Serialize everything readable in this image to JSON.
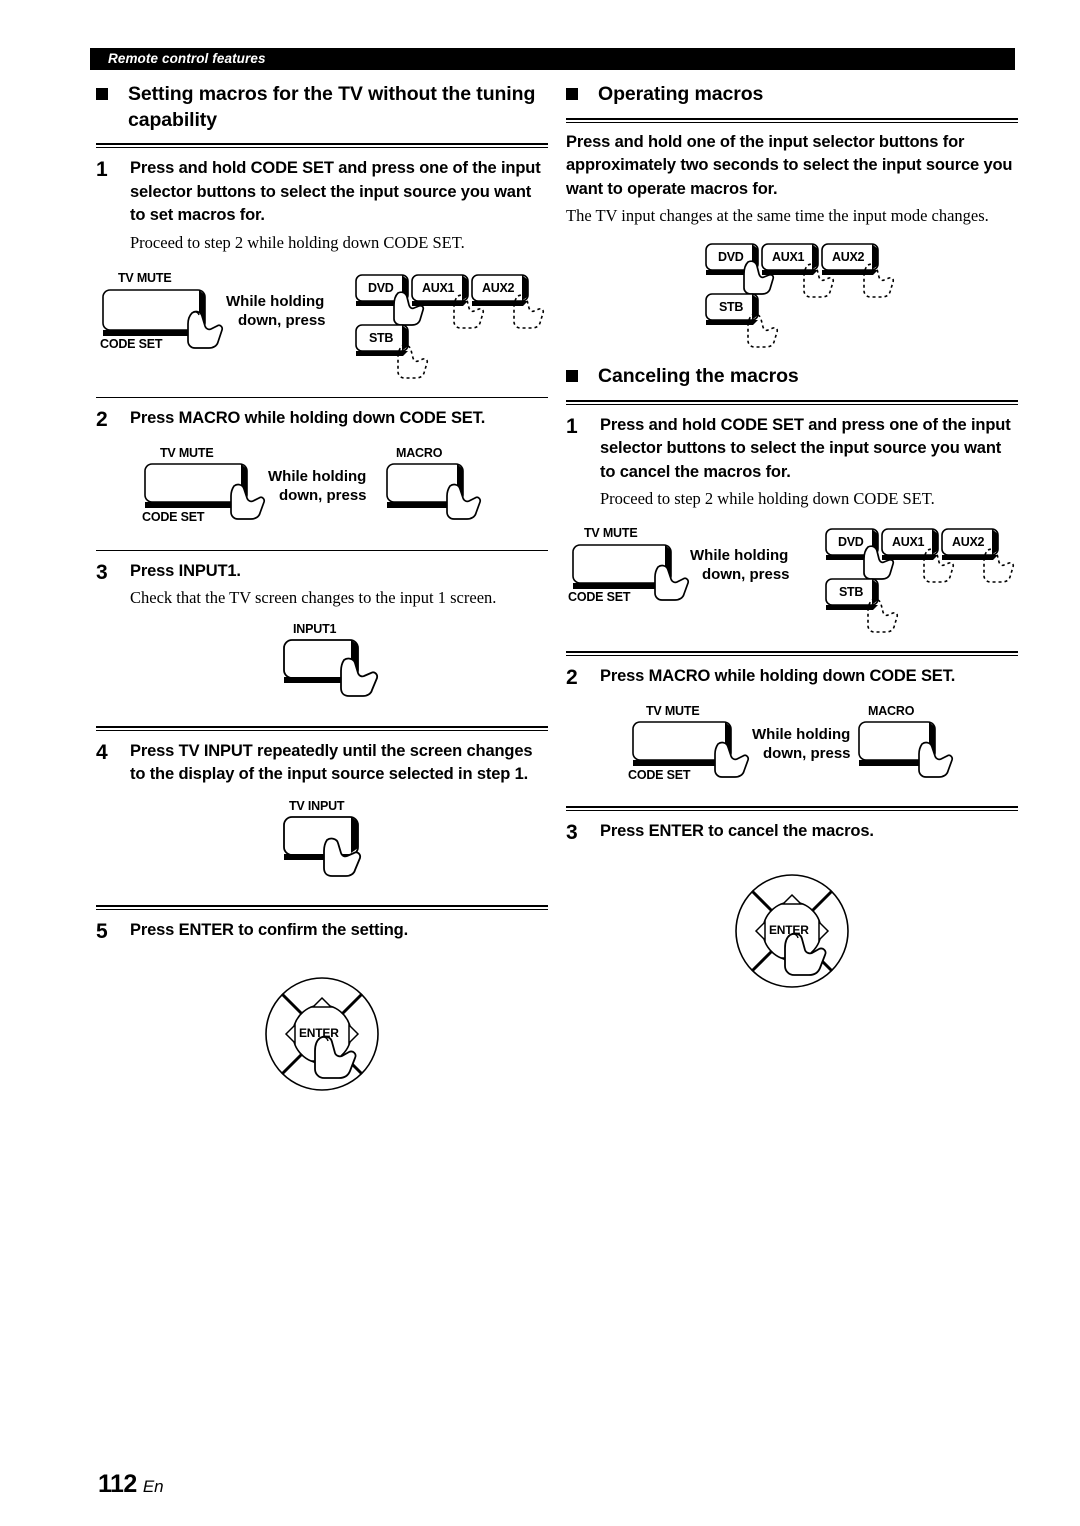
{
  "header": {
    "running_title": "Remote control features"
  },
  "footer": {
    "page_number": "112",
    "language": "En"
  },
  "left_column": {
    "section": {
      "title": "Setting macros for the TV without the tuning capability"
    },
    "steps": [
      {
        "number": "1",
        "title": "Press and hold CODE SET and press one of the input selector buttons to select the input source you want to set macros for.",
        "note": "Proceed to step 2 while holding down CODE SET.",
        "figure": {
          "type": "code-set-and-sources",
          "mute_label": "TV MUTE",
          "codeset_label": "CODE SET",
          "caption_line1": "While holding",
          "caption_line2": "down, press",
          "source_keys": [
            "DVD",
            "AUX1",
            "AUX2",
            "STB"
          ]
        }
      },
      {
        "number": "2",
        "title": "Press MACRO while holding down CODE SET.",
        "figure": {
          "type": "code-set-and-macro",
          "mute_label": "TV MUTE",
          "codeset_label": "CODE SET",
          "caption_line1": "While holding",
          "caption_line2": "down, press",
          "macro_label": "MACRO"
        }
      },
      {
        "number": "3",
        "title": "Press INPUT1.",
        "note": "Check that the TV screen changes to the input 1 screen.",
        "figure": {
          "type": "single-key",
          "key_label": "INPUT1"
        }
      },
      {
        "number": "4",
        "title": "Press TV INPUT repeatedly until the screen changes to the display of the input source selected in step 1.",
        "figure": {
          "type": "single-key",
          "key_label": "TV INPUT"
        }
      },
      {
        "number": "5",
        "title": "Press ENTER to confirm the setting.",
        "figure": {
          "type": "enter-pad",
          "enter_label": "ENTER"
        }
      }
    ]
  },
  "right_column": {
    "sections": [
      {
        "title": "Operating macros",
        "lead": "Press and hold one of the input selector buttons for approximately two seconds to select the input source you want to operate macros for.",
        "note": "The TV input changes at the same time the input mode changes.",
        "figure": {
          "type": "source-keys-only",
          "source_keys": [
            "DVD",
            "AUX1",
            "AUX2",
            "STB"
          ]
        }
      },
      {
        "title": "Canceling the macros",
        "steps": [
          {
            "number": "1",
            "title": "Press and hold CODE SET and press one of the input selector buttons to select the input source you want to cancel the macros for.",
            "note": "Proceed to step 2 while holding down CODE SET.",
            "figure": {
              "type": "code-set-and-sources",
              "mute_label": "TV MUTE",
              "codeset_label": "CODE SET",
              "caption_line1": "While holding",
              "caption_line2": "down, press",
              "source_keys": [
                "DVD",
                "AUX1",
                "AUX2",
                "STB"
              ]
            }
          },
          {
            "number": "2",
            "title": "Press MACRO while holding down CODE SET.",
            "figure": {
              "type": "code-set-and-macro",
              "mute_label": "TV MUTE",
              "codeset_label": "CODE SET",
              "caption_line1": "While holding",
              "caption_line2": "down, press",
              "macro_label": "MACRO"
            }
          },
          {
            "number": "3",
            "title": "Press ENTER to cancel the macros.",
            "figure": {
              "type": "enter-pad",
              "enter_label": "ENTER"
            }
          }
        ]
      }
    ]
  }
}
